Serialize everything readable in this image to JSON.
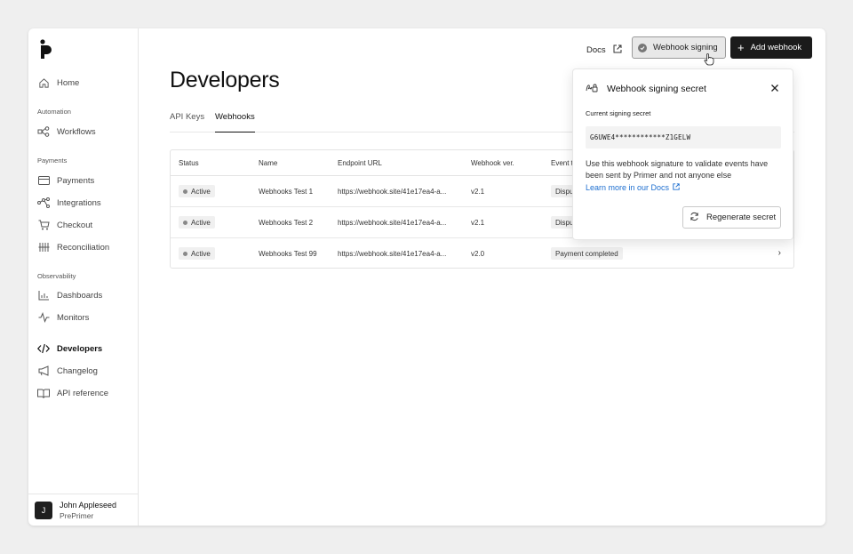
{
  "sidebar": {
    "home": "Home",
    "section_automation": "Automation",
    "workflows": "Workflows",
    "section_payments": "Payments",
    "payments": "Payments",
    "integrations": "Integrations",
    "checkout": "Checkout",
    "reconciliation": "Reconciliation",
    "section_observability": "Observability",
    "dashboards": "Dashboards",
    "monitors": "Monitors",
    "developers": "Developers",
    "changelog": "Changelog",
    "api_reference": "API reference",
    "user": {
      "initial": "J",
      "name": "John Appleseed",
      "org": "PrePrimer"
    }
  },
  "header": {
    "docs": "Docs",
    "webhook_signing": "Webhook signing",
    "add_webhook": "Add webhook"
  },
  "page": {
    "title": "Developers",
    "tabs": [
      "API Keys",
      "Webhooks"
    ]
  },
  "table": {
    "columns": [
      "Status",
      "Name",
      "Endpoint URL",
      "Webhook ver.",
      "Event t"
    ],
    "rows": [
      {
        "status": "Active",
        "name": "Webhooks Test 1",
        "url": "https://webhook.site/41e17ea4-a...",
        "version": "v2.1",
        "event": "Dispu"
      },
      {
        "status": "Active",
        "name": "Webhooks Test 2",
        "url": "https://webhook.site/41e17ea4-a...",
        "version": "v2.1",
        "event": "Dispu"
      },
      {
        "status": "Active",
        "name": "Webhooks Test 99",
        "url": "https://webhook.site/41e17ea4-a...",
        "version": "v2.0",
        "event": "Payment completed"
      }
    ]
  },
  "popover": {
    "title": "Webhook signing secret",
    "label": "Current signing secret",
    "secret": "G6UWE4************Z1GELW",
    "description": "Use this webhook signature to validate events have been sent by Primer and not anyone else",
    "link": "Learn more in our Docs",
    "regenerate": "Regenerate secret"
  },
  "colors": {
    "accent": "#1e6fd0",
    "primary_button": "#1b1b1b",
    "background": "#efefef"
  }
}
